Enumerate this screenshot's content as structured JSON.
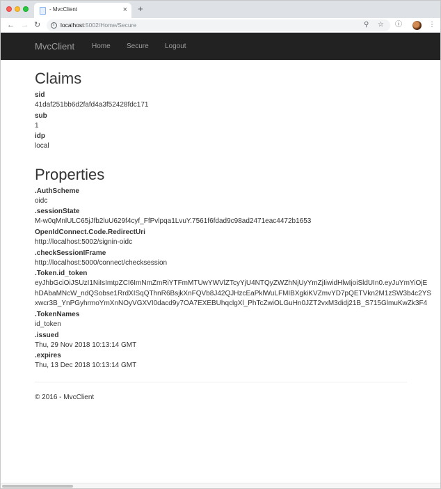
{
  "browser": {
    "tab_title": "- MvcClient",
    "tab_close": "×",
    "new_tab": "+",
    "back_icon": "arrow-left",
    "forward_icon": "arrow-right",
    "reload_icon": "reload",
    "url_host": "localhost",
    "url_path": ":5002/Home/Secure",
    "url_info_glyph": "i",
    "omnibox_icons": [
      "zoom-icon",
      "star-icon"
    ],
    "menu_glyph": "⋮"
  },
  "navbar": {
    "brand": "MvcClient",
    "links": [
      "Home",
      "Secure",
      "Logout"
    ],
    "background": "#222222"
  },
  "claims": {
    "heading": "Claims",
    "items": [
      {
        "key": "sid",
        "value": "41daf251bb6d2fafd4a3f52428fdc171"
      },
      {
        "key": "sub",
        "value": "1"
      },
      {
        "key": "idp",
        "value": "local"
      }
    ]
  },
  "properties": {
    "heading": "Properties",
    "auth_scheme": {
      "key": ".AuthScheme",
      "value": "oidc"
    },
    "session_state": {
      "key": ".sessionState",
      "value": "M-w0qMnlULC65jJfb2luU629f4cyf_FfPvlpqa1LvuY.7561f6fdad9c98ad2471eac4472b1653"
    },
    "redirect_uri": {
      "key": "OpenIdConnect.Code.RedirectUri",
      "value": "http://localhost:5002/signin-oidc"
    },
    "check_session": {
      "key": ".checkSessionIFrame",
      "value": "http://localhost:5000/connect/checksession"
    },
    "id_token": {
      "key": ".Token.id_token",
      "lines": [
        "eyJhbGciOiJSUzI1NiIsImtpZCI6ImNmZmRiYTFmMTUwYWVlZTcyYjU4NTQyZWZhNjUyYmZjIiwidHlwIjoiSldUIn0.eyJuYmYiOjE",
        "hDAbaMNcW_ndQSobse1RrdXISqQThnR6BsjkXnFQVb8J42QJHzcEaPklWuLFMIBXgkiKVZmvYD7pQETVkn2M1zSW3b4c2YS",
        "xwcr3B_YnPGyhrmoYmXnNOyVGXVI0dacd9y7OA7EXEBUhqclgXl_PhTcZwiOLGuHn0JZT2vxM3didj21B_S715GlmuKwZk3F4"
      ]
    },
    "token_names": {
      "key": ".TokenNames",
      "value": "id_token"
    },
    "issued": {
      "key": ".issued",
      "value": "Thu, 29 Nov 2018 10:13:14 GMT"
    },
    "expires": {
      "key": ".expires",
      "value": "Thu, 13 Dec 2018 10:13:14 GMT"
    }
  },
  "footer": {
    "text": "© 2016 - MvcClient"
  }
}
